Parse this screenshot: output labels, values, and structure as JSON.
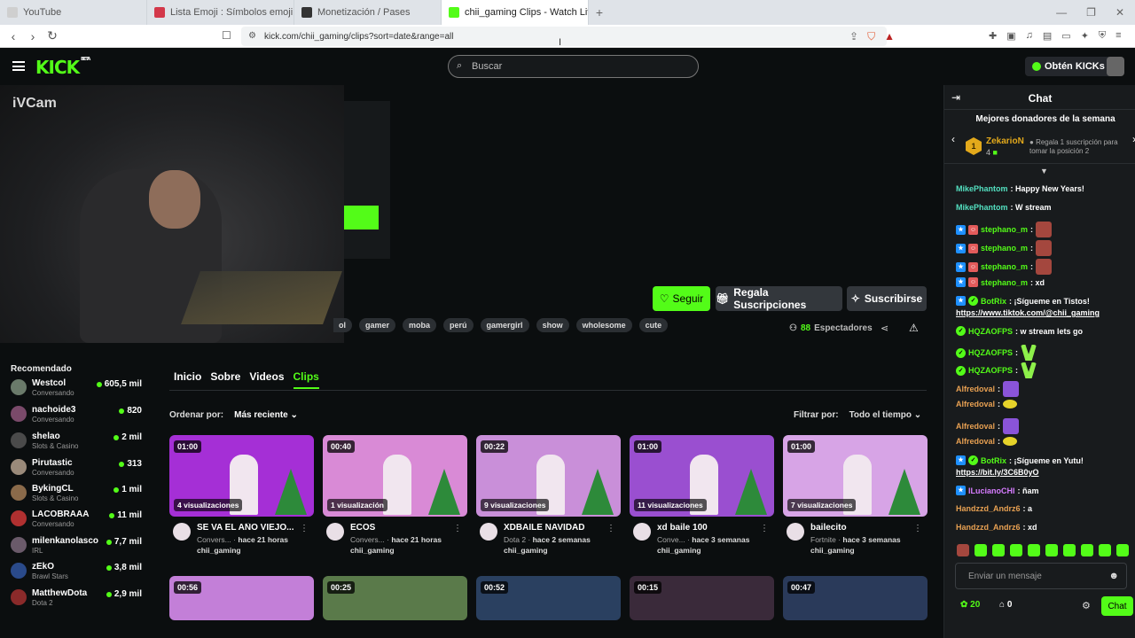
{
  "browser": {
    "tabs": [
      {
        "title": "YouTube",
        "active": false,
        "favicon_color": "#cfcfcf"
      },
      {
        "title": "Lista Emoji : Símbolos emoji nativos",
        "active": false,
        "favicon_color": "#d3384a"
      },
      {
        "title": "Monetización / Pases",
        "active": false,
        "favicon_color": "#333333"
      },
      {
        "title": "chii_gaming Clips - Watch Live",
        "active": true,
        "favicon_color": "#53fc18"
      }
    ],
    "new_tab": "+",
    "url": "kick.com/chii_gaming/clips?sort=date&range=all"
  },
  "header": {
    "logo": "KICK",
    "logo_badge": "BETA",
    "search_placeholder": "Buscar",
    "get_kicks": "Obtén KICKs"
  },
  "stream": {
    "cam_label": "iVCam",
    "follow": "Seguir",
    "gift_subs": "Regala Suscripciones",
    "subscribe": "Suscribirse",
    "tags": [
      "ol",
      "gamer",
      "moba",
      "perú",
      "gamergirl",
      "show",
      "wholesome",
      "cute"
    ],
    "viewers_count": "88",
    "viewers_label": "Espectadores"
  },
  "recommended": {
    "title": "Recomendado",
    "channels": [
      {
        "name": "Westcol",
        "category": "Conversando",
        "viewers": "605,5 mil",
        "avatar_color": "#6a7a6a"
      },
      {
        "name": "nachoide3",
        "category": "Conversando",
        "viewers": "820",
        "avatar_color": "#7a4a6a"
      },
      {
        "name": "shelao",
        "category": "Slots & Casino",
        "viewers": "2 mil",
        "avatar_color": "#4a4a4a"
      },
      {
        "name": "Pirutastic",
        "category": "Conversando",
        "viewers": "313",
        "avatar_color": "#9a8a7a"
      },
      {
        "name": "BykingCL",
        "category": "Slots & Casino",
        "viewers": "1 mil",
        "avatar_color": "#8a6a4a"
      },
      {
        "name": "LACOBRAAA",
        "category": "Conversando",
        "viewers": "11 mil",
        "avatar_color": "#b03030"
      },
      {
        "name": "milenkanolasco",
        "category": "IRL",
        "viewers": "7,7 mil",
        "avatar_color": "#6a5a6a"
      },
      {
        "name": "zEkO",
        "category": "Brawl Stars",
        "viewers": "3,8 mil",
        "avatar_color": "#2a4a8a"
      },
      {
        "name": "MatthewDota",
        "category": "Dota 2",
        "viewers": "2,9 mil",
        "avatar_color": "#8a2a2a"
      }
    ]
  },
  "content_tabs": [
    {
      "label": "Inicio",
      "active": false
    },
    {
      "label": "Sobre",
      "active": false
    },
    {
      "label": "Videos",
      "active": false
    },
    {
      "label": "Clips",
      "active": true
    }
  ],
  "sort": {
    "label": "Ordenar por:",
    "value": "Más reciente"
  },
  "filter": {
    "label": "Filtrar por:",
    "value": "Todo el tiempo"
  },
  "clips": [
    {
      "duration": "01:00",
      "views": "4 visualizaciones",
      "title": "SE VA EL AÑO VIEJO...",
      "category": "Convers...",
      "time": "hace 21 horas",
      "channel": "chii_gaming",
      "bg": "#a52fd6"
    },
    {
      "duration": "00:40",
      "views": "1 visualización",
      "title": "ECOS",
      "category": "Convers...",
      "time": "hace 21 horas",
      "channel": "chii_gaming",
      "bg": "#d98ad6"
    },
    {
      "duration": "00:22",
      "views": "9 visualizaciones",
      "title": "XDBAILE NAVIDAD",
      "category": "Dota 2",
      "time": "hace 2 semanas",
      "channel": "chii_gaming",
      "bg": "#c98fd9"
    },
    {
      "duration": "01:00",
      "views": "11 visualizaciones",
      "title": "xd baile 100",
      "category": "Conve...",
      "time": "hace 3 semanas",
      "channel": "chii_gaming",
      "bg": "#9a4fd0"
    },
    {
      "duration": "01:00",
      "views": "7 visualizaciones",
      "title": "bailecito",
      "category": "Fortnite",
      "time": "hace 3 semanas",
      "channel": "chii_gaming",
      "bg": "#d7a4e6"
    }
  ],
  "clips_row2": [
    {
      "duration": "00:56",
      "bg": "#c37fd8"
    },
    {
      "duration": "00:25",
      "bg": "#5a7a4a"
    },
    {
      "duration": "00:52",
      "bg": "#2a4060"
    },
    {
      "duration": "00:15",
      "bg": "#3a2a3a"
    },
    {
      "duration": "00:47",
      "bg": "#2a3a5a"
    }
  ],
  "chat": {
    "title": "Chat",
    "donors_title": "Mejores donadores de la semana",
    "top_donor": {
      "rank": "1",
      "name": "ZekarioN",
      "amount": "4"
    },
    "donor_cta": "Regala 1 suscripción para tomar la posición 2",
    "messages": [
      {
        "user": "MikePhantom",
        "text": ": Happy New Years!"
      },
      {
        "user": "MikePhantom",
        "text": ": W stream"
      },
      {
        "user": "stephano_m",
        "text": ":"
      },
      {
        "user": "stephano_m",
        "text": ":"
      },
      {
        "user": "stephano_m",
        "text": ":"
      },
      {
        "user": "stephano_m",
        "text": ": xd"
      },
      {
        "user": "BotRix",
        "text": ": ¡Sígueme en Tistos!"
      },
      {
        "user": "",
        "text": "https://www.tiktok.com/@chii_gaming"
      },
      {
        "user": "HQZAOFPS",
        "text": ": w stream lets go"
      },
      {
        "user": "HQZAOFPS",
        "text": ":"
      },
      {
        "user": "HQZAOFPS",
        "text": ":"
      },
      {
        "user": "Alfredoval",
        "text": ":"
      },
      {
        "user": "Alfredoval",
        "text": ":"
      },
      {
        "user": "Alfredoval",
        "text": ":"
      },
      {
        "user": "Alfredoval",
        "text": ":"
      },
      {
        "user": "BotRix",
        "text": ": ¡Sígueme en Yutu!"
      },
      {
        "user": "",
        "text": "https://bit.ly/3C6B0yO"
      },
      {
        "user": "ILucianoCHI",
        "text": ": ñam"
      },
      {
        "user": "Handzzd_Andrz6",
        "text": ": a"
      },
      {
        "user": "Handzzd_Andrz6",
        "text": ": xd"
      }
    ],
    "input_placeholder": "Enviar un mensaje",
    "kicks": "20",
    "gifts": "0",
    "send": "Chat"
  }
}
